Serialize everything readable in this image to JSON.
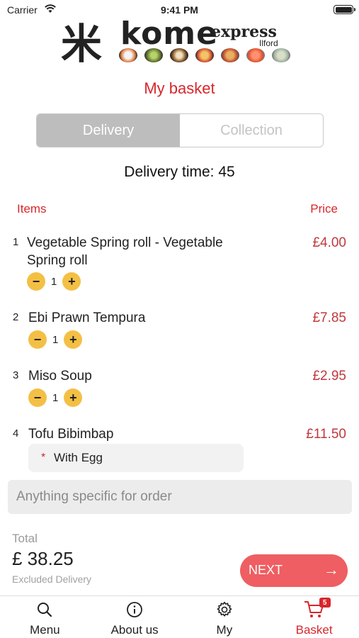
{
  "status_bar": {
    "carrier": "Carrier",
    "time": "9:41 PM"
  },
  "header": {
    "logo_kanji": "米",
    "logo_name": "kome",
    "logo_express": "express",
    "logo_location": "Ilford",
    "title": "My basket"
  },
  "order_type": {
    "options": [
      "Delivery",
      "Collection"
    ],
    "selected": "Delivery"
  },
  "delivery_time": "Delivery time: 45",
  "table_headers": {
    "items": "Items",
    "price": "Price"
  },
  "items": [
    {
      "number": "1",
      "name": "Vegetable Spring roll - Vegetable Spring roll",
      "price": "£4.00",
      "quantity": "1"
    },
    {
      "number": "2",
      "name": "Ebi Prawn Tempura",
      "price": "£7.85",
      "quantity": "1"
    },
    {
      "number": "3",
      "name": "Miso Soup",
      "price": "£2.95",
      "quantity": "1"
    },
    {
      "number": "4",
      "name": "Tofu Bibimbap",
      "price": "£11.50",
      "option": "With Egg",
      "option_marker": "*"
    }
  ],
  "order_note": {
    "placeholder": "Anything specific for order"
  },
  "total": {
    "label": "Total",
    "value": "£ 38.25",
    "note": "Excluded Delivery"
  },
  "next_button": {
    "label": "NEXT",
    "arrow": "→"
  },
  "stepper": {
    "minus": "−",
    "plus": "+"
  },
  "tab_bar": {
    "tabs": [
      {
        "label": "Menu",
        "icon": "search-icon"
      },
      {
        "label": "About us",
        "icon": "info-icon"
      },
      {
        "label": "My",
        "icon": "gear-icon"
      },
      {
        "label": "Basket",
        "icon": "cart-icon",
        "badge": "5",
        "active": true
      }
    ]
  },
  "colors": {
    "accent_red": "#d8262b",
    "price_red": "#c0383c",
    "stepper_yellow": "#f3c045",
    "next_button": "#ee5e62",
    "segment_active": "#bdbdbd"
  }
}
